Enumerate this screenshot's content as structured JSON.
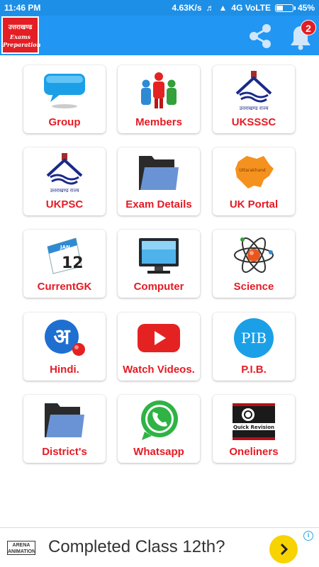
{
  "status_bar": {
    "time": "11:46 PM",
    "network_speed": "4.63K/s",
    "network_type": "4G VoLTE",
    "battery_percent": "45%",
    "battery_level": 0.45
  },
  "app_bar": {
    "logo_line1": "उत्तराखण्ड",
    "logo_line2": "Exams",
    "logo_line3": "Preparation",
    "notification_count": "2",
    "accent_color": "#2196f3"
  },
  "grid": {
    "label_color": "#e51b24",
    "tiles": [
      {
        "label": "Group",
        "icon": "speech-bubble-icon"
      },
      {
        "label": "Members",
        "icon": "people-icon"
      },
      {
        "label": "UKSSSC",
        "icon": "uttarakhand-emblem-icon"
      },
      {
        "label": "UKPSC",
        "icon": "uttarakhand-emblem-icon"
      },
      {
        "label": "Exam Details",
        "icon": "folder-icon"
      },
      {
        "label": "UK Portal",
        "icon": "uttarakhand-map-icon"
      },
      {
        "label": "CurrentGK",
        "icon": "calendar-icon"
      },
      {
        "label": "Computer",
        "icon": "monitor-icon"
      },
      {
        "label": "Science",
        "icon": "atom-icon"
      },
      {
        "label": "Hindi.",
        "icon": "hindi-letter-icon"
      },
      {
        "label": "Watch Videos.",
        "icon": "youtube-icon"
      },
      {
        "label": "P.I.B.",
        "icon": "pib-icon"
      },
      {
        "label": "District's",
        "icon": "folder-icon"
      },
      {
        "label": "Whatsapp",
        "icon": "whatsapp-icon"
      },
      {
        "label": "Oneliners",
        "icon": "quick-revision-icon"
      }
    ],
    "emblem_caption": "उत्तराखण्ड राज्य",
    "map_caption": "Uttarakhand",
    "calendar_month": "JAN",
    "calendar_day": "12",
    "hindi_letter": "अ",
    "pib_text": "PIB",
    "revision_text": "Quick Revision"
  },
  "ad": {
    "brand_line1": "ARENA",
    "brand_line2": "ANIMATION",
    "text": "Completed Class 12th?"
  }
}
